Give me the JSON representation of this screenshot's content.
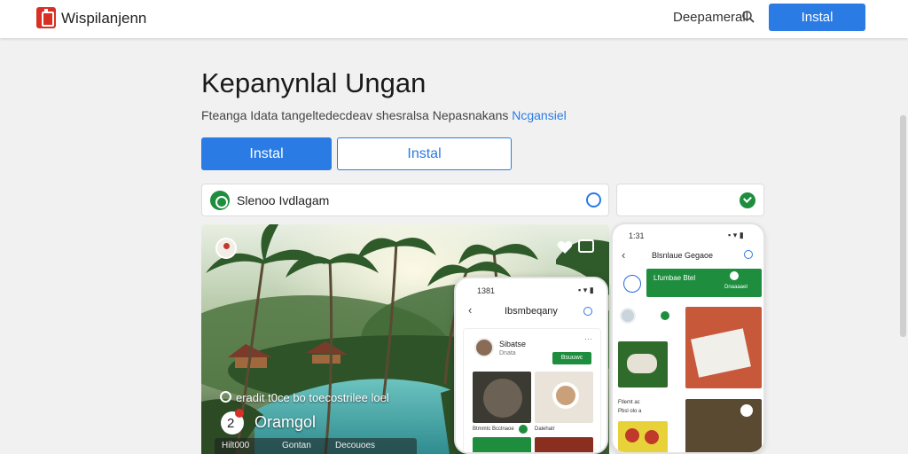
{
  "header": {
    "app_name": "Wispilanjenn",
    "nav_link": "Deepamerall",
    "install_label": "Instal"
  },
  "hero": {
    "title": "Kepanynlal Ungan",
    "subtitle": "Fteanga Idata tangeltedecdeav shesralsa Nepasnakans",
    "subtitle_link": "Ncgansiel",
    "primary_button": "Instal",
    "secondary_button": "Instal"
  },
  "info_card": {
    "label": "Slenoo Ivdlagam"
  },
  "photo_overlay": {
    "caption": "eradit t0ce bo toecostrilee loel",
    "title": "Oramgol",
    "badge_number": "2",
    "strip_items": [
      "Hilt000",
      "Gontan",
      "Decouoes"
    ]
  },
  "phone_1": {
    "time": "1381",
    "title": "Ibsmbeqany",
    "profile_name": "Sibatse",
    "profile_sub": "Dnata",
    "follow_label": "Bsuuwc",
    "tile_captions": [
      "Btmmtc Bcclnaoe",
      "Dalehatr"
    ]
  },
  "phone_2": {
    "time": "1:31",
    "title": "Blsnlaue Gegaoe",
    "banner_left": "Lfumbae Btel",
    "banner_right": "Dnaaaaet",
    "tile_captions": [
      "Ftlemt ac",
      "Pbsl olo a"
    ]
  },
  "colors": {
    "accent_blue": "#2a7be4",
    "brand_red": "#d93025",
    "success_green": "#1e8e3e"
  },
  "icons": [
    "app-logo-icon",
    "search-icon",
    "check-circle-icon",
    "heart-icon",
    "tv-icon",
    "clock-icon",
    "back-arrow-icon"
  ]
}
